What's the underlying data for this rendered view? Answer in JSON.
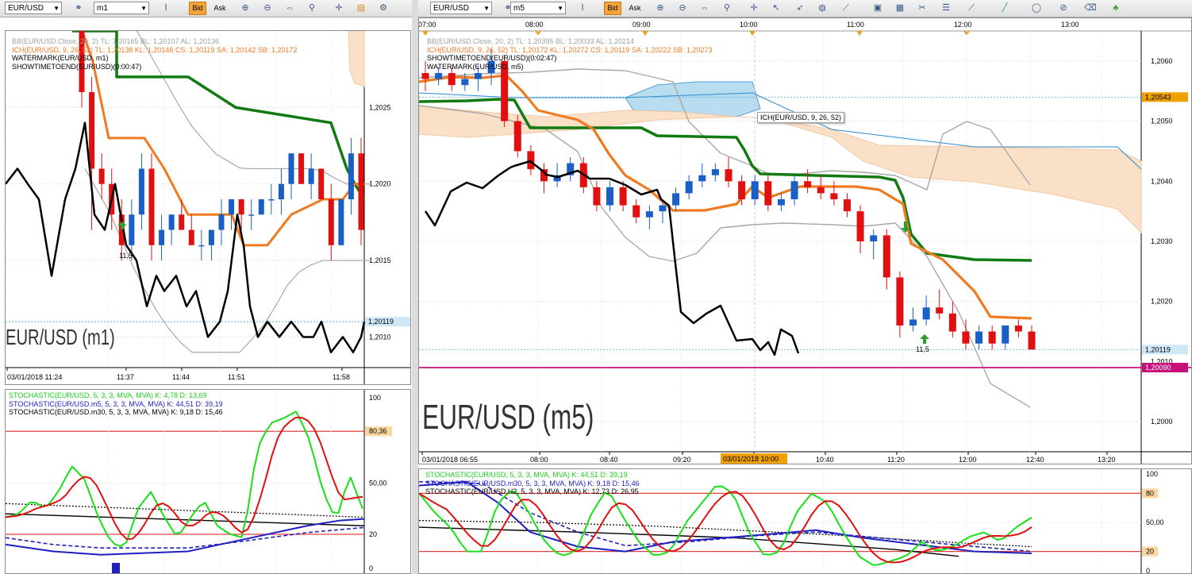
{
  "left": {
    "toolbar": {
      "symbol": "EUR/USD",
      "timeframe": "m1",
      "bid_label": "Bid",
      "ask_label": "Ask"
    },
    "price_chart": {
      "indicator_lines": [
        {
          "text": "BB(EUR/USD.Close, 20, 2)  TL: 1,20165  BL: 1,20107  AL: 1,20136",
          "color": "#a0a0a0"
        },
        {
          "text": "ICH(EUR/USD, 9, 26, 52)  TL: 1,20138  KL: 1,20146  CS: 1,20119  SA: 1,20142  SB: 1,20172",
          "color": "#f07a20"
        },
        {
          "text": "WATERMARK(EUR/USD, m1)",
          "color": "#000000"
        },
        {
          "text": "SHOWTIMETOEND(EUR/USD)(0:00:47)",
          "color": "#000000"
        }
      ],
      "watermark": "EUR/USD (m1)",
      "price_labels": [
        "1,2025",
        "1,2020",
        "1,2015",
        "1,2010"
      ],
      "current_price": "1,20119",
      "time_labels": [
        "03/01/2018 11:24",
        "11:37",
        "11:44",
        "11:51",
        "11:58"
      ],
      "signal_label": "11,5"
    },
    "osc_chart": {
      "indicator_lines": [
        {
          "text": "STOCHASTIC(EUR/USD, 5, 3, 3, MVA, MVA)  K: 4,78  D: 13,69",
          "color": "#18d018"
        },
        {
          "text": "STOCHASTIC(EUR/USD.m5, 5, 3, 3, MVA, MVA)  K: 44,51  D: 39,19",
          "color": "#2020c0"
        },
        {
          "text": "STOCHASTIC(EUR/USD.m30, 5, 3, 3, MVA, MVA)  K: 9,18  D: 15,46",
          "color": "#000000"
        }
      ],
      "level_labels": [
        "100",
        "80,36",
        "50,00",
        "20",
        "0"
      ]
    }
  },
  "right": {
    "toolbar": {
      "symbol": "EUR/USD",
      "timeframe": "m5",
      "bid_label": "Bid",
      "ask_label": "Ask"
    },
    "top_time_labels": [
      "07:00",
      "08:00",
      "09:00",
      "10:00",
      "11:00",
      "12:00",
      "13:00"
    ],
    "price_chart": {
      "indicator_lines": [
        {
          "text": "BB(EUR/USD.Close, 20, 2)  TL: 1,20395  BL: 1,20033  AL: 1,20214",
          "color": "#a0a0a0"
        },
        {
          "text": "ICH(EUR/USD, 9, 26, 52)  TL: 1,20172  KL: 1,20272  CS: 1,20119  SA: 1,20222  SB: 1,20273",
          "color": "#f07a20"
        },
        {
          "text": "SHOWTIMETOEND(EUR/USD)(0:02:47)",
          "color": "#000000"
        },
        {
          "text": "WATERMARK(EUR/USD, m5)",
          "color": "#000000"
        }
      ],
      "watermark": "EUR/USD (m5)",
      "tooltip": "ICH(EUR/USD, 9, 26, 52)",
      "price_labels": [
        "1,2060",
        "1,2050",
        "1,2040",
        "1,2030",
        "1,2020",
        "1,2010",
        "1,2000"
      ],
      "ref_price": "1,20543",
      "current_price": "1,20119",
      "magenta_price": "1,20090",
      "time_labels": [
        "03/01/2018 06:55",
        "08:00",
        "08:40",
        "09:20",
        "10:00",
        "10:40",
        "11:20",
        "12:00",
        "12:40",
        "13:20"
      ],
      "highlight_time": "03/01/2018 10:00",
      "signal_label": "11,5"
    },
    "osc_chart": {
      "indicator_lines": [
        {
          "text": "STOCHASTIC(EUR/USD, 5, 3, 3, MVA, MVA)  K: 44,51  D: 39,19",
          "color": "#18d018"
        },
        {
          "text": "STOCHASTIC(EUR/USD.m30, 5, 3, 3, MVA, MVA)  K: 9,18  D: 15,46",
          "color": "#2020c0"
        },
        {
          "text": "STOCHASTIC(EUR/USD.H2, 5, 3, 3, MVA, MVA)  K: 12,73  D: 26,95",
          "color": "#000000"
        }
      ],
      "level_labels": [
        "100",
        "80",
        "50,00",
        "20",
        "0"
      ]
    }
  },
  "colors": {
    "bull": "#1a5fc8",
    "bear": "#e01010",
    "ichimoku_tenkan": "#f07a20",
    "ichimoku_kijun": "#117a11",
    "chikou": "#000000",
    "bollinger": "#a8a8a8",
    "cloud_bull": "#b8dcf0",
    "cloud_bear": "#fbe0c8",
    "overbought": "#e04040",
    "stoch_k": "#18e018",
    "stoch_d": "#e01010"
  },
  "chart_data": [
    {
      "type": "candlestick",
      "title": "EUR/USD (m1)",
      "ylim": [
        1.2008,
        1.203
      ],
      "ohlc": [
        [
          1.2031,
          1.2032,
          1.2025,
          1.2026
        ],
        [
          1.2026,
          1.2027,
          1.2017,
          1.2021
        ],
        [
          1.2021,
          1.2022,
          1.2019,
          1.202
        ],
        [
          1.202,
          1.2021,
          1.2017,
          1.2018
        ],
        [
          1.2018,
          1.2019,
          1.2015,
          1.2016
        ],
        [
          1.2016,
          1.2019,
          1.2015,
          1.2018
        ],
        [
          1.2018,
          1.2022,
          1.2017,
          1.2021
        ],
        [
          1.2021,
          1.2022,
          1.2015,
          1.2016
        ],
        [
          1.2016,
          1.2018,
          1.2015,
          1.2017
        ],
        [
          1.2017,
          1.2018,
          1.2016,
          1.2018
        ],
        [
          1.2018,
          1.2019,
          1.2017,
          1.2017
        ],
        [
          1.2017,
          1.2018,
          1.2016,
          1.2016
        ],
        [
          1.2016,
          1.2017,
          1.2015,
          1.2016
        ],
        [
          1.2016,
          1.2017,
          1.2015,
          1.2017
        ],
        [
          1.2017,
          1.2019,
          1.2016,
          1.2018
        ],
        [
          1.2018,
          1.2019,
          1.2017,
          1.2019
        ],
        [
          1.2019,
          1.2019,
          1.2017,
          1.2018
        ],
        [
          1.2018,
          1.2019,
          1.2017,
          1.2018
        ],
        [
          1.2018,
          1.2019,
          1.2018,
          1.2019
        ],
        [
          1.2019,
          1.202,
          1.2018,
          1.2019
        ],
        [
          1.2019,
          1.2021,
          1.2018,
          1.202
        ],
        [
          1.202,
          1.2022,
          1.2019,
          1.2022
        ],
        [
          1.2022,
          1.2022,
          1.202,
          1.202
        ],
        [
          1.202,
          1.2022,
          1.2019,
          1.2021
        ],
        [
          1.2021,
          1.2021,
          1.2019,
          1.2019
        ],
        [
          1.2019,
          1.202,
          1.2015,
          1.2016
        ],
        [
          1.2016,
          1.2019,
          1.2016,
          1.2019
        ],
        [
          1.2019,
          1.2023,
          1.2018,
          1.2022
        ],
        [
          1.2022,
          1.2023,
          1.2016,
          1.2017
        ]
      ]
    },
    {
      "type": "candlestick",
      "title": "EUR/USD (m5)",
      "ylim": [
        1.1995,
        1.2065
      ],
      "ohlc": [
        [
          1.2058,
          1.206,
          1.2055,
          1.2057
        ],
        [
          1.2057,
          1.2059,
          1.2056,
          1.2058
        ],
        [
          1.2058,
          1.2059,
          1.2055,
          1.2056
        ],
        [
          1.2056,
          1.2058,
          1.2055,
          1.2057
        ],
        [
          1.2057,
          1.2059,
          1.2055,
          1.2058
        ],
        [
          1.2058,
          1.2062,
          1.2056,
          1.206
        ],
        [
          1.206,
          1.2061,
          1.2049,
          1.205
        ],
        [
          1.205,
          1.2051,
          1.2044,
          1.2045
        ],
        [
          1.2045,
          1.2046,
          1.2041,
          1.2042
        ],
        [
          1.2042,
          1.2043,
          1.2038,
          1.204
        ],
        [
          1.204,
          1.2043,
          1.2039,
          1.2041
        ],
        [
          1.2041,
          1.2044,
          1.204,
          1.2043
        ],
        [
          1.2043,
          1.2044,
          1.2038,
          1.2039
        ],
        [
          1.2039,
          1.204,
          1.2035,
          1.2036
        ],
        [
          1.2036,
          1.204,
          1.2035,
          1.2039
        ],
        [
          1.2039,
          1.204,
          1.2035,
          1.2036
        ],
        [
          1.2036,
          1.2037,
          1.2033,
          1.2034
        ],
        [
          1.2034,
          1.2036,
          1.2032,
          1.2035
        ],
        [
          1.2035,
          1.2037,
          1.2033,
          1.2036
        ],
        [
          1.2036,
          1.2039,
          1.2035,
          1.2038
        ],
        [
          1.2038,
          1.2041,
          1.2037,
          1.204
        ],
        [
          1.204,
          1.2043,
          1.2039,
          1.2041
        ],
        [
          1.2041,
          1.2043,
          1.204,
          1.2042
        ],
        [
          1.2042,
          1.2044,
          1.2039,
          1.204
        ],
        [
          1.204,
          1.2041,
          1.2036,
          1.2037
        ],
        [
          1.2037,
          1.2041,
          1.2036,
          1.204
        ],
        [
          1.204,
          1.2041,
          1.2035,
          1.2036
        ],
        [
          1.2036,
          1.2038,
          1.2035,
          1.2037
        ],
        [
          1.2037,
          1.2041,
          1.2036,
          1.204
        ],
        [
          1.204,
          1.2042,
          1.2038,
          1.2039
        ],
        [
          1.2039,
          1.2041,
          1.2037,
          1.2038
        ],
        [
          1.2038,
          1.204,
          1.2036,
          1.2037
        ],
        [
          1.2037,
          1.2038,
          1.2034,
          1.2035
        ],
        [
          1.2035,
          1.2036,
          1.2028,
          1.203
        ],
        [
          1.203,
          1.2032,
          1.2027,
          1.2031
        ],
        [
          1.2031,
          1.2032,
          1.2022,
          1.2024
        ],
        [
          1.2024,
          1.2025,
          1.2014,
          1.2016
        ],
        [
          1.2016,
          1.2019,
          1.2015,
          1.2017
        ],
        [
          1.2017,
          1.2021,
          1.2016,
          1.2019
        ],
        [
          1.2019,
          1.2022,
          1.2017,
          1.2018
        ],
        [
          1.2018,
          1.202,
          1.2014,
          1.2015
        ],
        [
          1.2015,
          1.2017,
          1.2012,
          1.2013
        ],
        [
          1.2013,
          1.2016,
          1.2012,
          1.2015
        ],
        [
          1.2015,
          1.2016,
          1.2012,
          1.2013
        ],
        [
          1.2013,
          1.2016,
          1.2012,
          1.2016
        ],
        [
          1.2016,
          1.2017,
          1.2014,
          1.2015
        ],
        [
          1.2015,
          1.2016,
          1.2012,
          1.2012
        ]
      ]
    }
  ]
}
